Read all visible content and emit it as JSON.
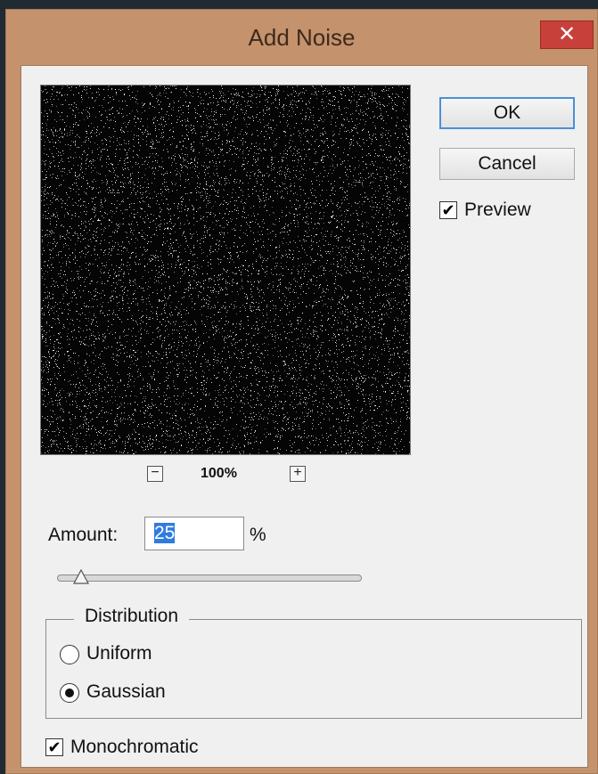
{
  "window": {
    "title": "Add Noise",
    "close_label": "✕"
  },
  "preview": {
    "zoom": "100%",
    "zoom_out_label": "−",
    "zoom_in_label": "+"
  },
  "buttons": {
    "ok": "OK",
    "cancel": "Cancel"
  },
  "preview_toggle": {
    "label": "Preview",
    "checked": true
  },
  "amount": {
    "label": "Amount:",
    "value": "25",
    "unit": "%",
    "slider_value": 25,
    "slider_max": 400
  },
  "distribution": {
    "title": "Distribution",
    "options": [
      {
        "label": "Uniform",
        "selected": false
      },
      {
        "label": "Gaussian",
        "selected": true
      }
    ]
  },
  "monochromatic": {
    "label": "Monochromatic",
    "checked": true
  },
  "colors": {
    "title_bar": "#c4926c",
    "close_button": "#c8403a",
    "selection": "#2f7be0",
    "default_border": "#4a90d9"
  }
}
